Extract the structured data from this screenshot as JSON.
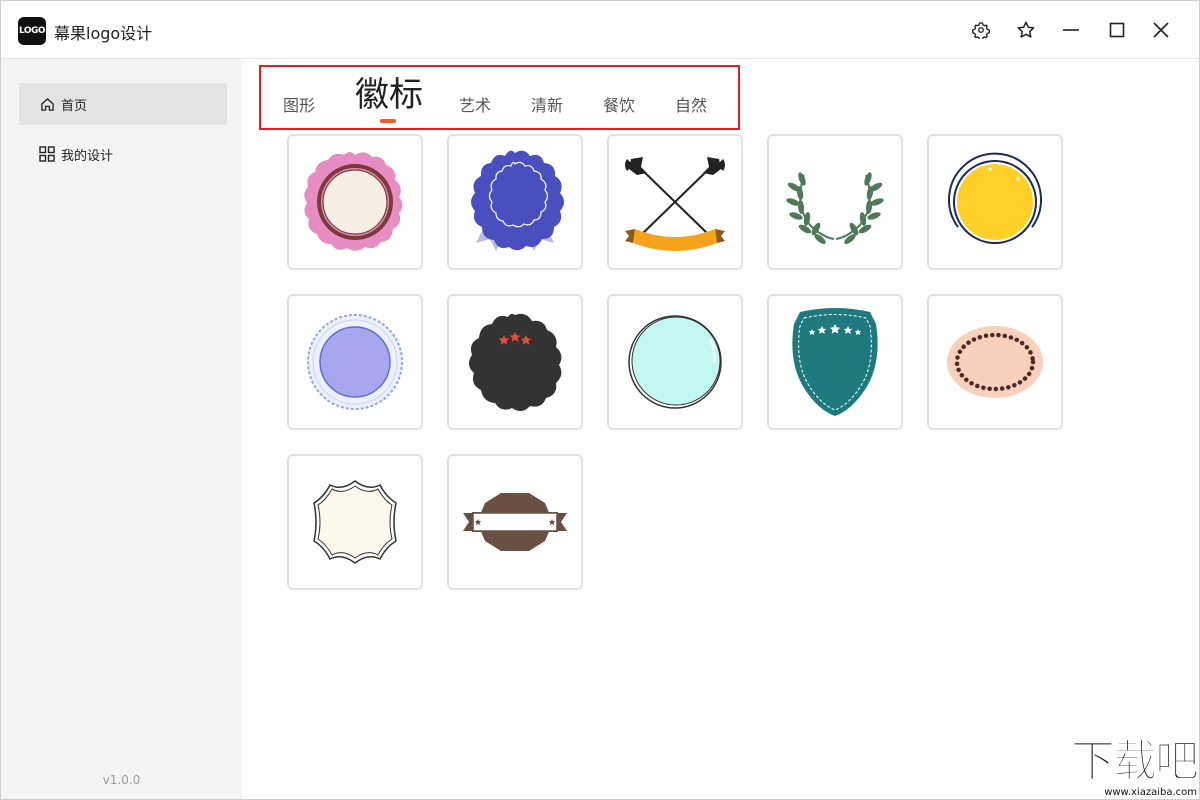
{
  "app": {
    "logo_text": "LOGO",
    "title": "幕果logo设计"
  },
  "window_controls": {
    "settings_icon": "gear-icon",
    "favorite_icon": "star-icon",
    "minimize_icon": "minimize-icon",
    "maximize_icon": "maximize-icon",
    "close_icon": "close-icon"
  },
  "sidebar": {
    "items": [
      {
        "label": "首页",
        "icon": "home-icon",
        "active": true
      },
      {
        "label": "我的设计",
        "icon": "grid-icon",
        "active": false
      }
    ],
    "version": "v1.0.0"
  },
  "tabs": [
    {
      "label": "图形",
      "active": false
    },
    {
      "label": "徽标",
      "active": true
    },
    {
      "label": "艺术",
      "active": false
    },
    {
      "label": "清新",
      "active": false
    },
    {
      "label": "餐饮",
      "active": false
    },
    {
      "label": "自然",
      "active": false
    }
  ],
  "accent_color": "#ee5a24",
  "highlight_border_color": "#e02020",
  "badges": [
    {
      "name": "pink-scalloped-badge",
      "colors": [
        "#e88cc4",
        "#7a3b3b",
        "#f8efe4"
      ]
    },
    {
      "name": "blue-rosette-badge",
      "colors": [
        "#4a4fc0",
        "#b9b8ea"
      ]
    },
    {
      "name": "crossed-axes-ribbon-badge",
      "colors": [
        "#222222",
        "#f5a31a",
        "#8a5a1a"
      ]
    },
    {
      "name": "laurel-wreath-badge",
      "colors": [
        "#4f7a5a"
      ]
    },
    {
      "name": "yellow-circle-badge",
      "colors": [
        "#ffd028",
        "#1a2a5a"
      ]
    },
    {
      "name": "lavender-lace-circle-badge",
      "colors": [
        "#a9a6f0",
        "#8fa9e0"
      ]
    },
    {
      "name": "dark-scalloped-star-badge",
      "colors": [
        "#333333",
        "#e94a3a"
      ]
    },
    {
      "name": "mint-circle-badge",
      "colors": [
        "#c2f7f2",
        "#333333"
      ]
    },
    {
      "name": "teal-shield-badge",
      "colors": [
        "#1f7a7f",
        "#ffffff"
      ]
    },
    {
      "name": "peach-beaded-oval-badge",
      "colors": [
        "#f8d0bc",
        "#4a2a2a"
      ]
    },
    {
      "name": "cream-frame-badge",
      "colors": [
        "#fcf8ea",
        "#333333"
      ]
    },
    {
      "name": "brown-banner-badge",
      "colors": [
        "#6a5042",
        "#ffffff"
      ]
    }
  ],
  "watermark": {
    "title": "下载吧",
    "url": "www.xiazaiba.com"
  }
}
